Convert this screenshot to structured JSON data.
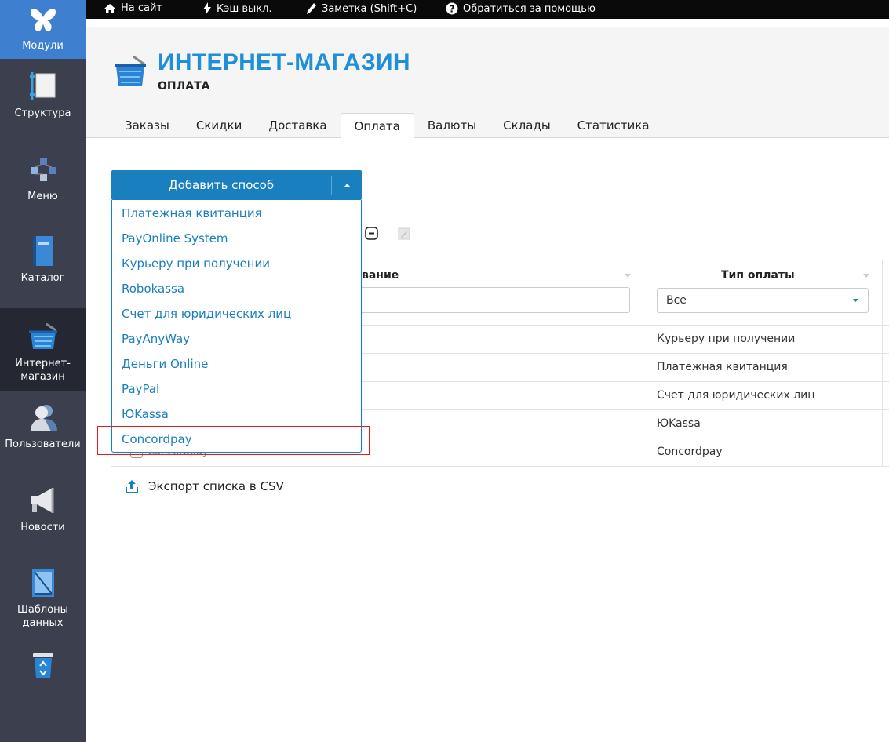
{
  "sidebar": {
    "items": [
      {
        "label": "Модули",
        "icon": "butterfly-icon"
      },
      {
        "label": "Структура",
        "icon": "structure-icon"
      },
      {
        "label": "Меню",
        "icon": "menu-tree-icon"
      },
      {
        "label": "Каталог",
        "icon": "catalog-book-icon"
      },
      {
        "label": "Интернет-магазин",
        "icon": "shop-basket-icon"
      },
      {
        "label": "Пользователи",
        "icon": "users-icon"
      },
      {
        "label": "Новости",
        "icon": "megaphone-icon"
      },
      {
        "label": "Шаблоны данных",
        "icon": "templates-icon"
      },
      {
        "label": "",
        "icon": "recycle-bin-icon"
      }
    ]
  },
  "topbar": {
    "site": "На сайт",
    "cache": "Кэш выкл.",
    "note": "Заметка (Shift+C)",
    "help": "Обратиться за помощью"
  },
  "header": {
    "title": "ИНТЕРНЕТ-МАГАЗИН",
    "subtitle": "ОПЛАТА"
  },
  "tabs": [
    "Заказы",
    "Скидки",
    "Доставка",
    "Оплата",
    "Валюты",
    "Склады",
    "Статистика"
  ],
  "active_tab": "Оплата",
  "add_button": {
    "label": "Добавить способ"
  },
  "dropdown": {
    "items": [
      "Платежная квитанция",
      "PayOnline System",
      "Курьеру при получении",
      "Robokassa",
      "Счет для юридических лиц",
      "PayAnyWay",
      "Деньги Online",
      "PayPal",
      "ЮKassa",
      "Concordpay"
    ],
    "highlighted": "Concordpay"
  },
  "table": {
    "columns": {
      "name": "Название",
      "name_visible": "вание",
      "type": "Тип оплаты"
    },
    "type_filter": "Все",
    "rows": [
      {
        "type": "Курьеру при получении"
      },
      {
        "type": "Платежная квитанция"
      },
      {
        "type": "Счет для юридических лиц"
      },
      {
        "type": "ЮKassa"
      },
      {
        "type": "Concordpay",
        "name": "Concordpay"
      }
    ]
  },
  "export": {
    "label": "Экспорт списка в CSV"
  },
  "colors": {
    "accent": "#1a7fbf",
    "title": "#1e8fd8",
    "sidebar": "#3b3f4e",
    "highlight": "#e01e1e"
  }
}
